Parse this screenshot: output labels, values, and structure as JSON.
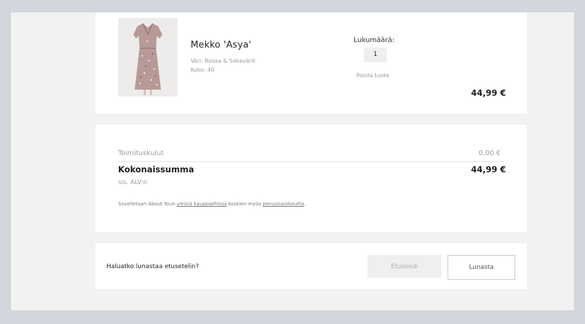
{
  "item": {
    "name": "Mekko 'Asya'",
    "color": "Väri: Roosa & Sekavärit",
    "size": "Koko: 40",
    "quantity_label": "Lukumäärä:",
    "quantity": "1",
    "remove_label": "Poista tuote",
    "price": "44,99 €"
  },
  "summary": {
    "shipping_label": "Toimituskulut",
    "shipping_value": "0,00 €",
    "total_label": "Kokonaissumma",
    "total_value": "44,99 €",
    "vat_note": "sis. ALV:n",
    "terms_prefix": "Sovelletaan About Youn ",
    "terms_link1": "yleisiä kauppaehtoja",
    "terms_middle": " koskien myös ",
    "terms_link2": "peruutusoikeutta",
    "terms_suffix": "."
  },
  "voucher": {
    "question": "Haluatko lunastaa etusetelin?",
    "input_placeholder": "Etukoodi",
    "button_label": "Lunasta"
  },
  "colors": {
    "background": "#d3d6dc",
    "page": "#f2f2f2",
    "card": "#ffffff",
    "muted_text": "#9a9a9a",
    "dress_pattern": "#b79a98"
  },
  "icons": {
    "product_image": "floral-dress-image"
  }
}
